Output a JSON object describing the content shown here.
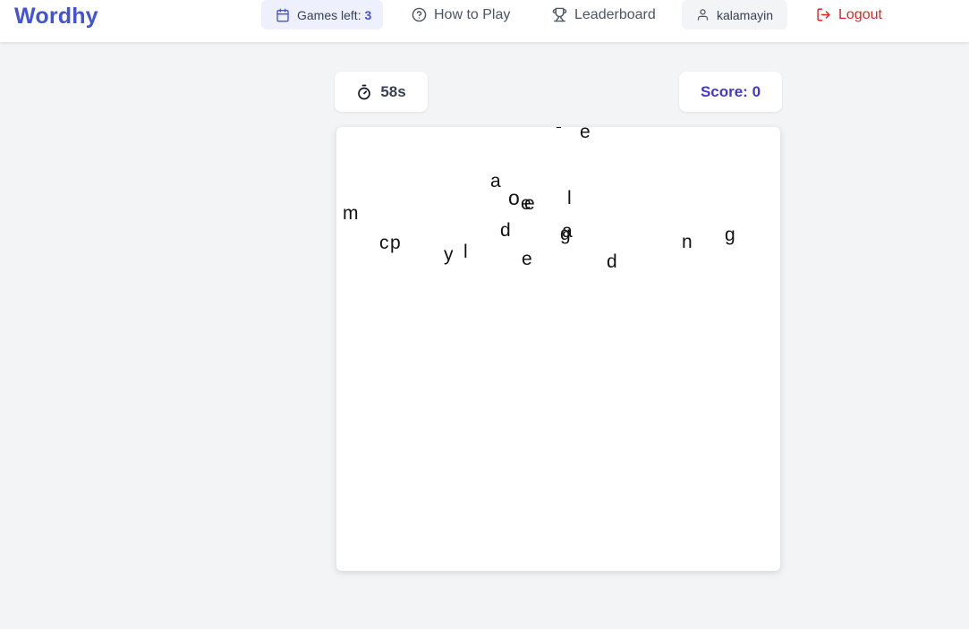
{
  "app": {
    "title": "Wordhy"
  },
  "nav": {
    "games_left_label": "Games left:",
    "games_left_count": "3",
    "how_to_play": "How to Play",
    "leaderboard": "Leaderboard",
    "username": "kalamayin",
    "logout": "Logout"
  },
  "game": {
    "timer": "58s",
    "score_label": "Score:",
    "score_value": "0",
    "letters": [
      "-",
      "e",
      "a",
      "o",
      "e",
      "e",
      "l",
      "m",
      "d",
      "g",
      "a",
      "c",
      "p",
      "y",
      "l",
      "e",
      "n",
      "g",
      "d"
    ]
  },
  "colors": {
    "brand": "#4353d6",
    "logout": "#dc2626",
    "background": "#f3f4f6"
  }
}
